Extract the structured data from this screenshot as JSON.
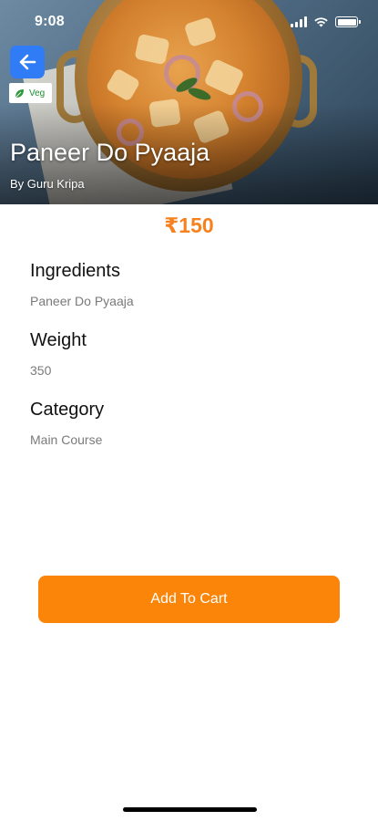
{
  "status_bar": {
    "time": "9:08",
    "icons": [
      "signal-icon",
      "wifi-icon",
      "battery-icon"
    ]
  },
  "hero": {
    "image": "paneer-curry-bowl",
    "back_icon": "arrow-left-icon",
    "veg_badge": {
      "icon": "leaf-icon",
      "label": "Veg",
      "color": "#1b8f2f"
    },
    "title": "Paneer Do Pyaaja",
    "by_line": "By Guru Kripa"
  },
  "price": "₹150",
  "details": [
    {
      "label": "Ingredients",
      "value": "Paneer Do Pyaaja"
    },
    {
      "label": "Weight",
      "value": "350"
    },
    {
      "label": "Category",
      "value": "Main Course"
    }
  ],
  "cart_button": {
    "label": "Add To Cart"
  },
  "colors": {
    "accent": "#f7821d",
    "button": "#fb8509",
    "back_button": "#2f7cf6"
  }
}
